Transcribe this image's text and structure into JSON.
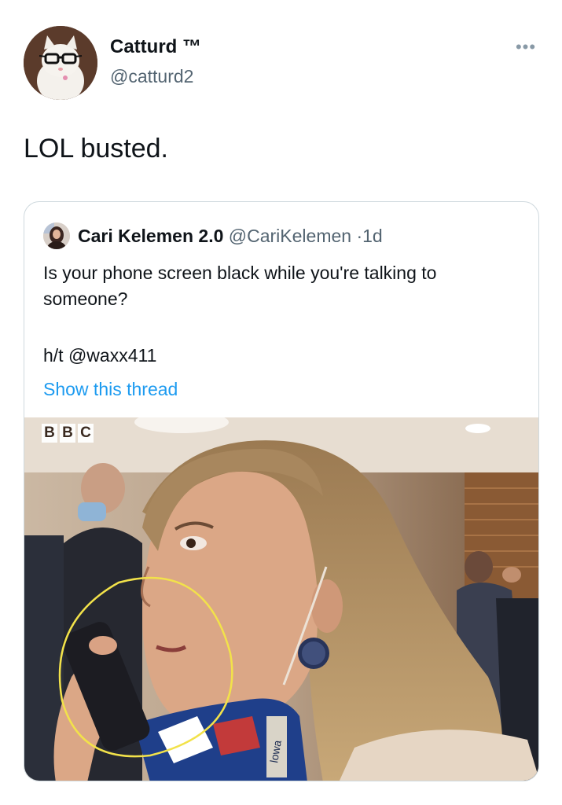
{
  "tweet": {
    "author": {
      "display_name": "Catturd ™",
      "handle": "@catturd2",
      "avatar_icon": "cat-with-glasses-avatar"
    },
    "more_icon": "more-dots-icon",
    "text": "LOL busted.",
    "quoted_tweet": {
      "author": {
        "display_name": "Cari Kelemen 2.0",
        "handle": "@CariKelemen",
        "separator": "·",
        "time": "1d"
      },
      "text_lines": [
        "Is your phone screen black while you're talking to",
        "someone?"
      ],
      "hat_tip": "h/t @waxx411",
      "show_thread": "Show this thread",
      "media": {
        "watermark_letters": [
          "B",
          "B",
          "C"
        ],
        "mask_text": "lowa",
        "annotation_color": "#f2e24a"
      }
    }
  },
  "colors": {
    "link": "#1d9bf0",
    "secondary_text": "#536471",
    "border": "#cfd9de"
  }
}
